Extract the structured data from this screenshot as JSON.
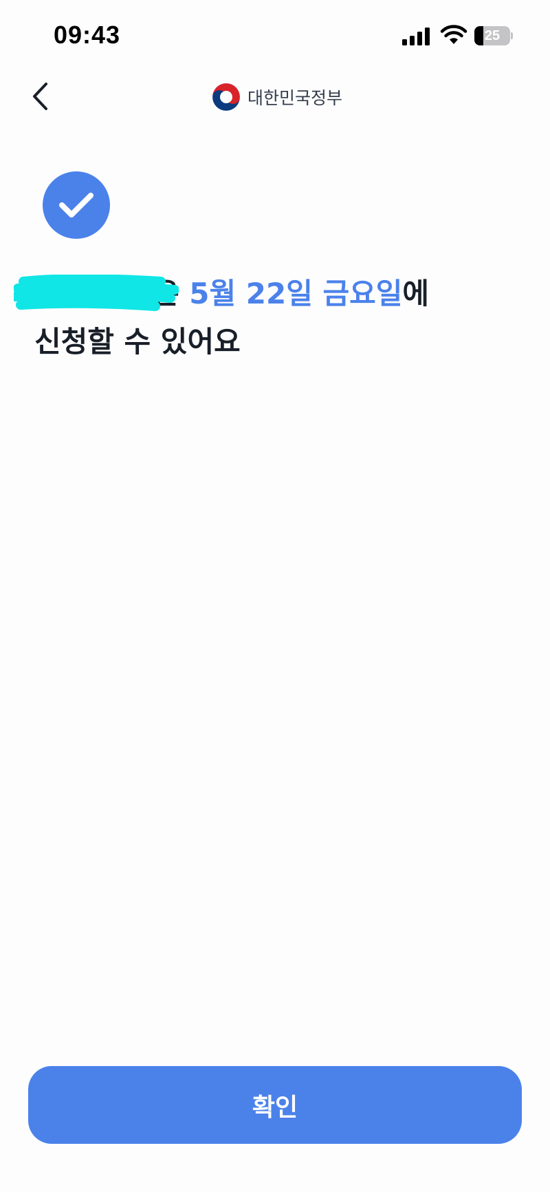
{
  "status_bar": {
    "time": "09:43",
    "battery_level": "25",
    "battery_fraction": 0.25
  },
  "nav": {
    "brand_name": "대한민국정부",
    "back_icon": "chevron-left-icon",
    "logo_icon": "taegeuk-emblem-icon"
  },
  "main": {
    "status_icon": "check-circle-icon",
    "headline": {
      "subject_suffix": "은 ",
      "date_highlight": "5월 22일 금요일",
      "line1_tail": "에",
      "line2": "신청할 수 있어요"
    }
  },
  "footer": {
    "confirm_label": "확인"
  },
  "colors": {
    "accent": "#4b82ea",
    "text": "#191f28",
    "redaction": "#10e6e6",
    "background": "#fdfdfe"
  }
}
